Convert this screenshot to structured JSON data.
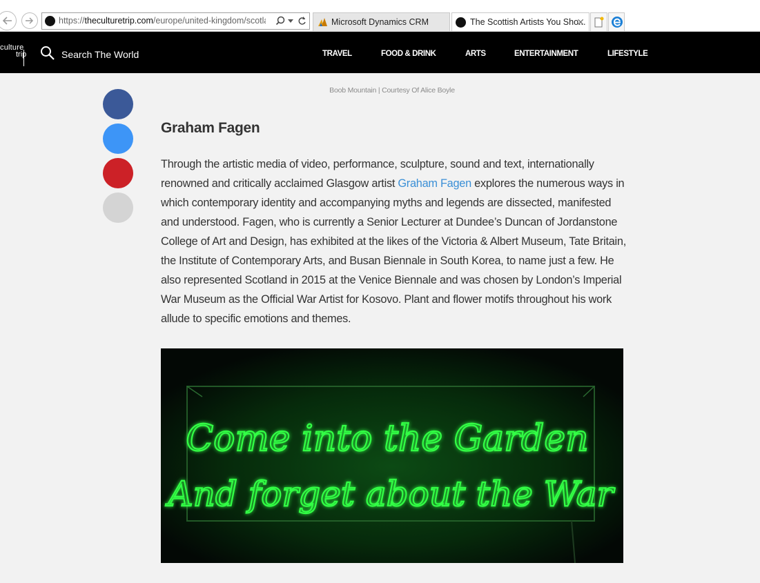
{
  "browser": {
    "url_domain": "theculturetrip.com",
    "url_path": "/europe/united-kingdom/scotla",
    "url_scheme": "https://",
    "tabs": [
      {
        "label": "Microsoft Dynamics CRM",
        "active": false
      },
      {
        "label": "The Scottish Artists You Sho...",
        "active": true
      }
    ]
  },
  "site": {
    "logo_line1": "culture",
    "logo_line2": "trip",
    "search_label": "Search The World",
    "menu": [
      "TRAVEL",
      "FOOD & DRINK",
      "ARTS",
      "ENTERTAINMENT",
      "LIFESTYLE"
    ]
  },
  "share": {
    "colors": [
      "#3b5998",
      "#3d95f7",
      "#cc2127",
      "#d4d4d4"
    ]
  },
  "article": {
    "caption": "Boob Mountain | Courtesy Of Alice Boyle",
    "heading": "Graham Fagen",
    "para_before_link": "Through the artistic media of video, performance, sculpture, sound and text, internationally renowned and critically acclaimed Glasgow artist ",
    "link_text": "Graham Fagen",
    "para_after_link": " explores the numerous ways in which contemporary identity and accompanying myths and legends are dissected, manifested and understood. Fagen, who is currently a Senior Lecturer at Dundee’s Duncan of Jordanstone College of Art and Design, has exhibited at the likes of the Victoria & Albert Museum, Tate Britain, the Institute of Contemporary Arts, and Busan Biennale in South Korea, to name just a few. He also represented Scotland in 2015 at the Venice Biennale and was chosen by London’s Imperial War Museum as the Official War Artist for Kosovo. Plant and flower motifs throughout his work allude to specific emotions and themes.",
    "image_line1": "Come into the Garden",
    "image_line2": "And forget about the War",
    "neon_color": "#33ff44"
  }
}
